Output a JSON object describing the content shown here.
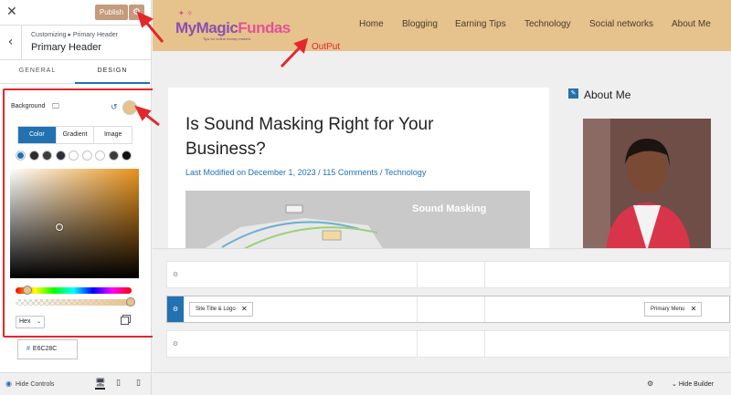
{
  "customizer": {
    "close_icon": "close-icon",
    "publish_label": "Publish",
    "breadcrumb": "Customizing ▸ Primary Header",
    "section_title": "Primary Header",
    "tabs": [
      {
        "label": "GENERAL"
      },
      {
        "label": "DESIGN"
      }
    ],
    "active_tab": "DESIGN",
    "background_label": "Background",
    "selected_color": "#E6C28C",
    "picker_tabs": [
      {
        "label": "Color"
      },
      {
        "label": "Gradient"
      },
      {
        "label": "Image"
      }
    ],
    "active_picker_tab": "Color",
    "presets": [
      "#2271b1",
      "#2c2c2c",
      "#3c3c3c",
      "#2b2f38",
      "#ffffff",
      "#ffffff",
      "#ffffff",
      "#3a3a3a",
      "#111111"
    ],
    "color_mode": "Hex",
    "hex_value": "E6C28C",
    "hide_controls_label": "Hide Controls"
  },
  "site": {
    "logo": {
      "part1": "MyMagic",
      "part2": "Fundas",
      "tagline": "Tips for online money makers"
    },
    "nav": [
      {
        "label": "Home"
      },
      {
        "label": "Blogging"
      },
      {
        "label": "Earning Tips"
      },
      {
        "label": "Technology"
      },
      {
        "label": "Social networks"
      },
      {
        "label": "About Me"
      }
    ],
    "annotation_label": "OutPut",
    "post": {
      "title": "Is Sound Masking Right for Your Business?",
      "meta": "Last Modified on December 1, 2023 / 115 Comments / Technology",
      "image_label": "Sound Masking"
    },
    "sidebar_heading": "About Me"
  },
  "builder": {
    "chips": [
      {
        "label": "Site Title & Logo"
      },
      {
        "label": "Primary Menu"
      }
    ],
    "hide_builder_label": "Hide Builder"
  },
  "colors": {
    "header_bg": "#E6C28C",
    "accent": "#2271b1",
    "annotation": "#e3272d",
    "publish": "#c59a7d"
  }
}
